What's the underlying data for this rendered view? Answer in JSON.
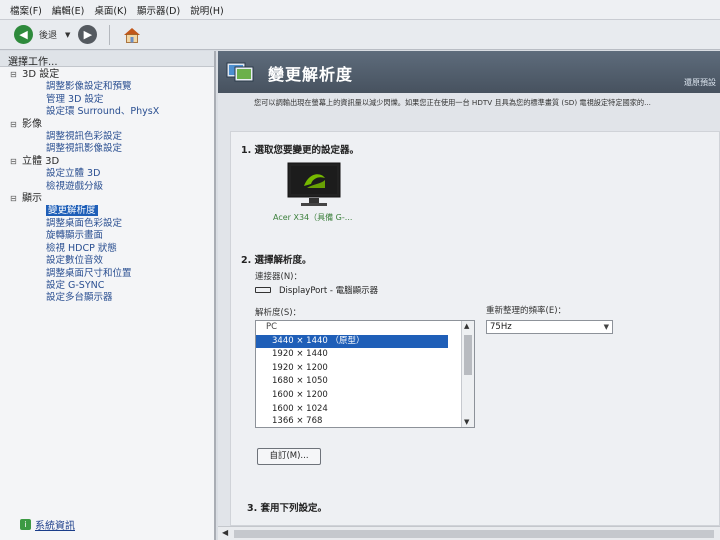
{
  "menu": [
    "檔案(F)",
    "編輯(E)",
    "桌面(K)",
    "顯示器(D)",
    "說明(H)"
  ],
  "toolbar": {
    "back_label": "後退"
  },
  "sidebar": {
    "title": "選擇工作...",
    "categories": [
      {
        "label": "3D 設定",
        "items": [
          "調整影像設定和預覽",
          "管理 3D 設定",
          "設定環 Surround、PhysX"
        ]
      },
      {
        "label": "影像",
        "items": [
          "調整視訊色彩設定",
          "調整視訊影像設定"
        ]
      },
      {
        "label": "立體 3D",
        "items": [
          "設定立體 3D",
          "檢視遊戲分級"
        ]
      },
      {
        "label": "顯示",
        "items": [
          "變更解析度",
          "調整桌面色彩設定",
          "旋轉顯示畫面",
          "檢視 HDCP 狀態",
          "設定數位音效",
          "調整桌面尺寸和位置",
          "設定 G-SYNC",
          "設定多台顯示器"
        ]
      }
    ],
    "footer_link": "系統資訊"
  },
  "main": {
    "title": "變更解析度",
    "restore": "還原預設",
    "description": "您可以調輸出現在螢幕上的資訊量以減少閃爍。如果您正在使用一台 HDTV 且具為您的標準畫質 (SD) 電視設定特定國家的...",
    "section1": "1. 選取您要變更的設定器。",
    "monitor_label": "Acer X34（具備 G-...",
    "section2": "2. 選擇解析度。",
    "connector_label": "連接器(N)：",
    "connector_value": "DisplayPort - 電腦顯示器",
    "resolution_label": "解析度(S)：",
    "resolutions": {
      "group": "PC",
      "items": [
        "3440 × 1440 （原型）",
        "1920 × 1440",
        "1920 × 1200",
        "1680 × 1050",
        "1600 × 1200",
        "1600 × 1024",
        "1366 × 768"
      ]
    },
    "refresh_label": "重新整理的頻率(E)：",
    "refresh_value": "75Hz",
    "custom_button": "自訂(M)...",
    "section3": "3. 套用下列設定。"
  },
  "colors": {
    "accent": "#1f5fb8",
    "banner": "#56626f",
    "link": "#2a4f91"
  }
}
